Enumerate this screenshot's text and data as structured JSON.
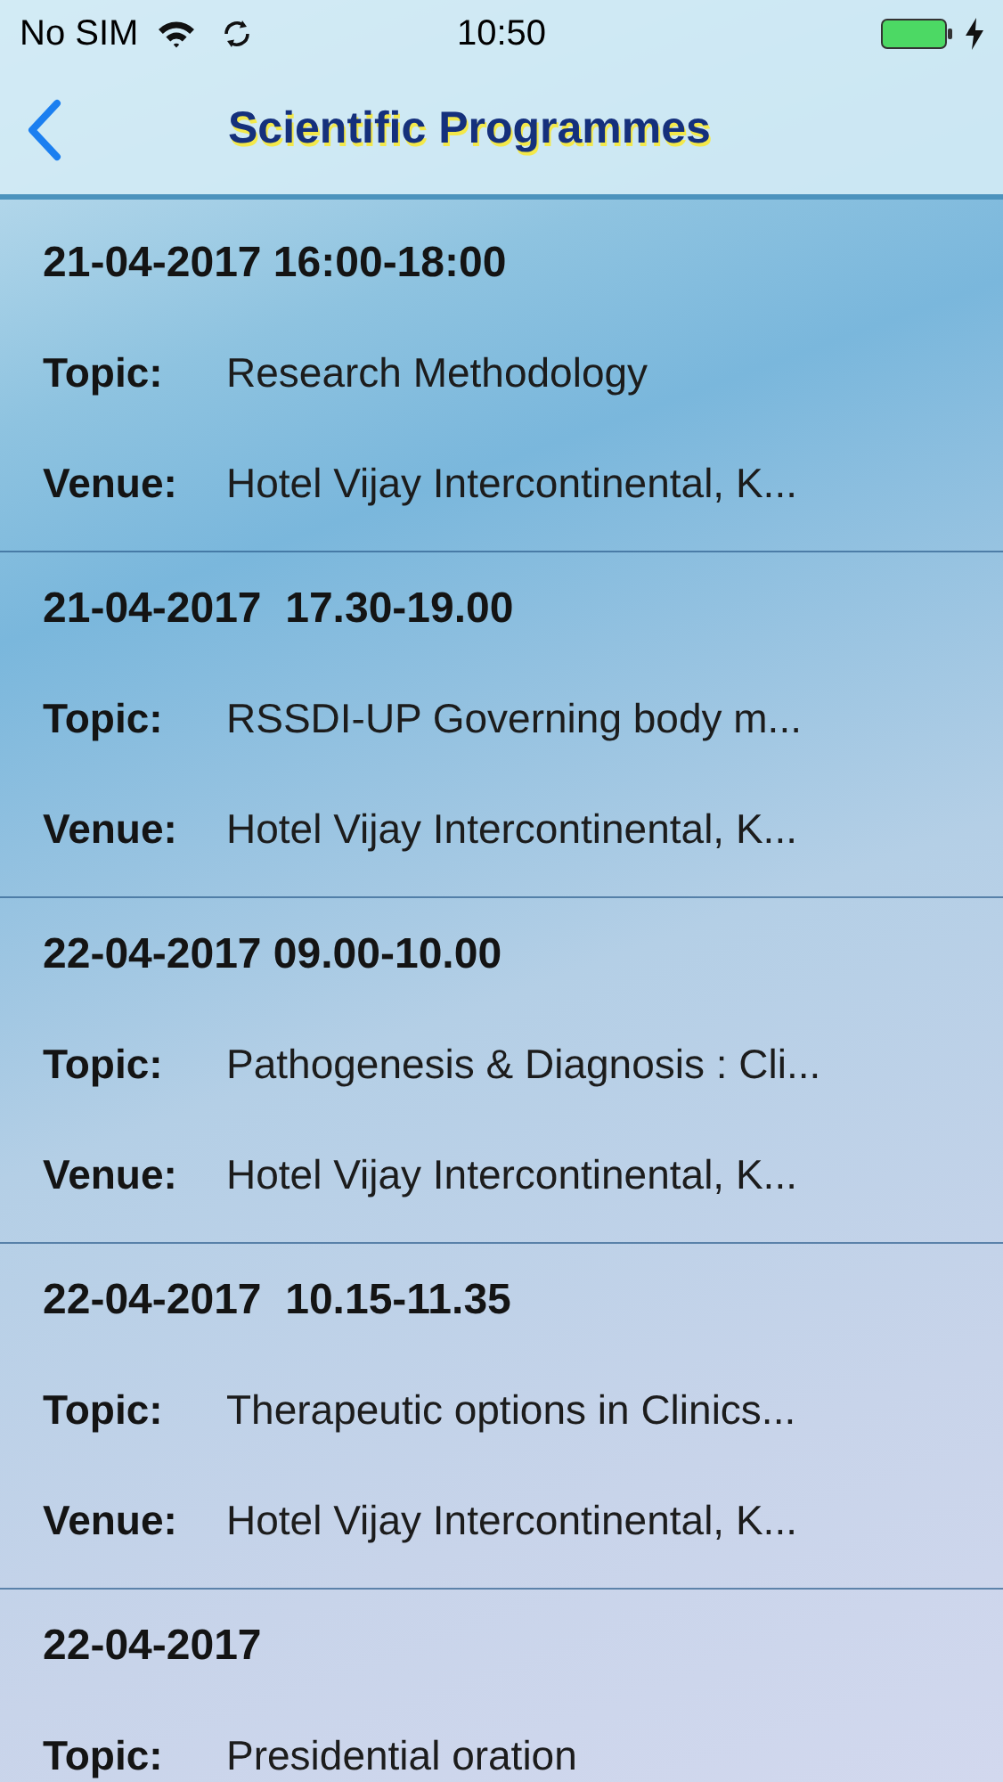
{
  "status_bar": {
    "carrier": "No SIM",
    "time": "10:50"
  },
  "nav": {
    "title": "Scientific Programmes"
  },
  "sessions": [
    {
      "heading": "21-04-2017 16:00-18:00",
      "fields": [
        {
          "label": "Topic:",
          "value": "Research Methodology"
        },
        {
          "label": "Venue:",
          "value": "Hotel Vijay Intercontinental, K..."
        }
      ]
    },
    {
      "heading": "21-04-2017  17.30-19.00",
      "fields": [
        {
          "label": "Topic:",
          "value": "RSSDI-UP Governing body m..."
        },
        {
          "label": "Venue:",
          "value": "Hotel Vijay Intercontinental, K..."
        }
      ]
    },
    {
      "heading": "22-04-2017 09.00-10.00",
      "fields": [
        {
          "label": "Topic:",
          "value": "Pathogenesis & Diagnosis : Cli..."
        },
        {
          "label": "Venue:",
          "value": "Hotel Vijay Intercontinental, K..."
        }
      ]
    },
    {
      "heading": "22-04-2017  10.15-11.35",
      "fields": [
        {
          "label": "Topic:",
          "value": "Therapeutic options in Clinics..."
        },
        {
          "label": "Venue:",
          "value": "Hotel Vijay Intercontinental, K..."
        }
      ]
    },
    {
      "heading": "22-04-2017",
      "fields": [
        {
          "label": "Topic:",
          "value": "Presidential oration"
        }
      ]
    }
  ]
}
